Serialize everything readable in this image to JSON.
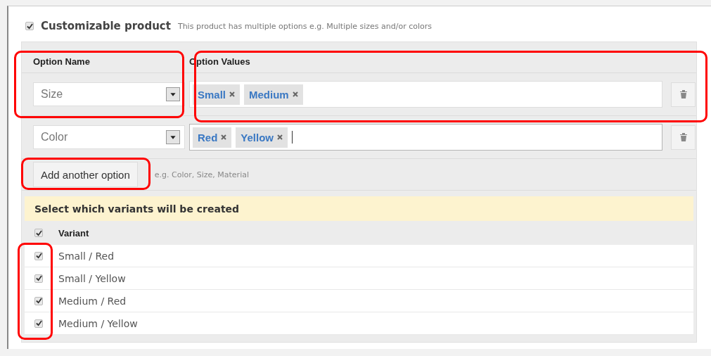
{
  "product_option": {
    "checked": true,
    "title": "Customizable product",
    "hint": "This product has multiple options e.g. Multiple sizes and/or colors"
  },
  "columns": [
    "Option Name",
    "Option Values"
  ],
  "options": [
    {
      "name": "Size",
      "values": [
        "Small",
        "Medium"
      ],
      "focused": false
    },
    {
      "name": "Color",
      "values": [
        "Red",
        "Yellow"
      ],
      "focused": true
    }
  ],
  "add_button": "Add another option",
  "add_hint": "e.g. Color, Size, Material",
  "variants_heading": "Select which variants will be created",
  "variants_header": {
    "label": "Variant",
    "checked": true
  },
  "variants": [
    {
      "label": "Small / Red",
      "checked": true
    },
    {
      "label": "Small / Yellow",
      "checked": true
    },
    {
      "label": "Medium / Red",
      "checked": true
    },
    {
      "label": "Medium / Yellow",
      "checked": true
    }
  ],
  "highlight_frames": [
    {
      "kind": "option_name"
    },
    {
      "kind": "option_values"
    },
    {
      "kind": "add_button"
    },
    {
      "kind": "variant_checkboxes"
    }
  ]
}
